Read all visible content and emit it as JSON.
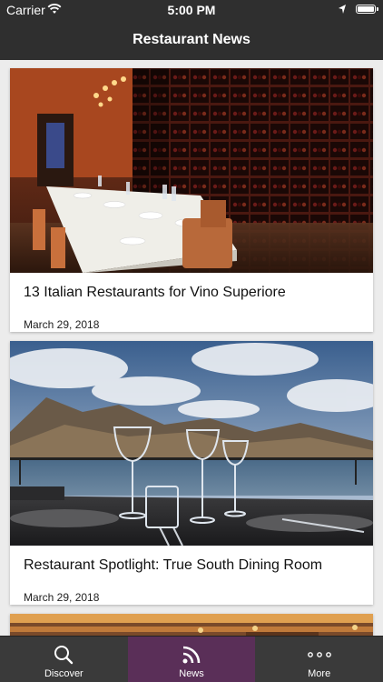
{
  "status_bar": {
    "carrier": "Carrier",
    "time": "5:00 PM"
  },
  "nav": {
    "title": "Restaurant News"
  },
  "articles": [
    {
      "title": "13 Italian Restaurants for Vino Superiore",
      "date": "March 29, 2018"
    },
    {
      "title": "Restaurant Spotlight: True South Dining Room",
      "date": "March 29, 2018"
    }
  ],
  "tabs": [
    {
      "label": "Discover",
      "icon": "search-icon"
    },
    {
      "label": "News",
      "icon": "rss-icon",
      "active": true
    },
    {
      "label": "More",
      "icon": "more-dots-icon"
    }
  ],
  "colors": {
    "bar": "#2f2f2f",
    "active_tab": "#5a2f58",
    "background": "#ececec"
  }
}
